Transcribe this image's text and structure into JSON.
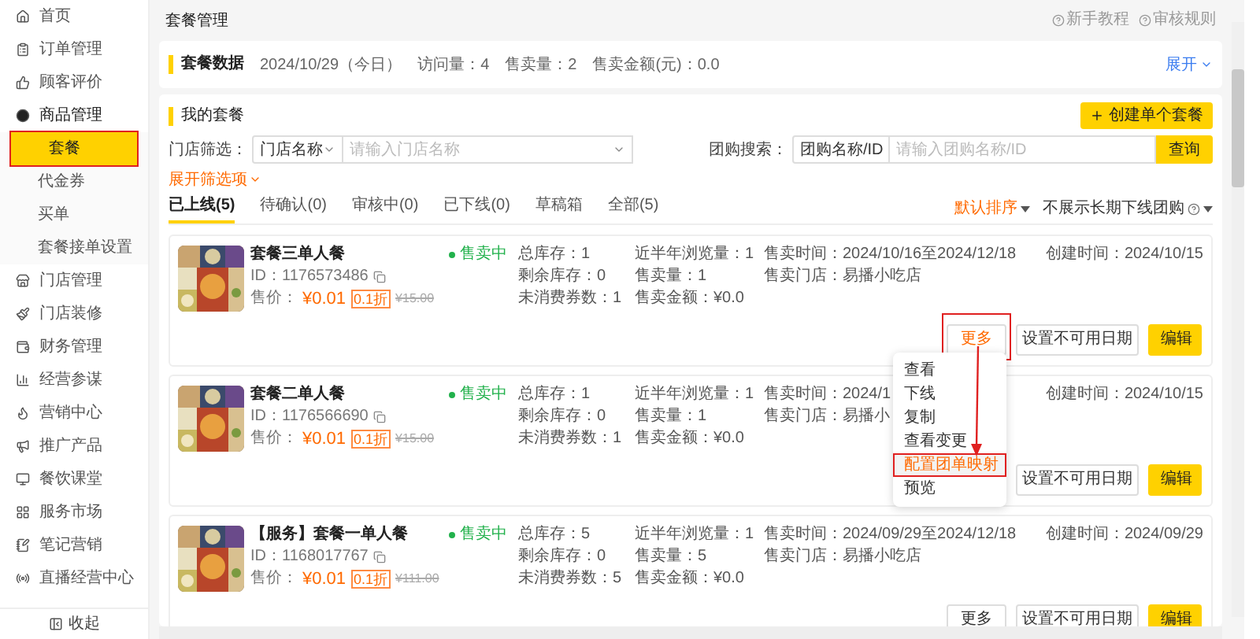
{
  "sidebar": {
    "items": [
      {
        "label": "首页"
      },
      {
        "label": "订单管理"
      },
      {
        "label": "顾客评价"
      },
      {
        "label": "商品管理",
        "expanded": true,
        "children": [
          {
            "label": "套餐",
            "selected": true,
            "highlighted": true
          },
          {
            "label": "代金券",
            "selected": false,
            "highlighted": false
          },
          {
            "label": "买单",
            "selected": false,
            "highlighted": false
          },
          {
            "label": "套餐接单设置",
            "selected": false,
            "highlighted": false
          }
        ]
      },
      {
        "label": "门店管理"
      },
      {
        "label": "门店装修"
      },
      {
        "label": "财务管理"
      },
      {
        "label": "经营参谋"
      },
      {
        "label": "营销中心"
      },
      {
        "label": "推广产品"
      },
      {
        "label": "餐饮课堂"
      },
      {
        "label": "服务市场"
      },
      {
        "label": "笔记营销"
      },
      {
        "label": "直播经营中心"
      }
    ],
    "collapse": "收起"
  },
  "page_title": "套餐管理",
  "help_links": [
    "新手教程",
    "审核规则"
  ],
  "stats_card": {
    "title": "套餐数据",
    "date": "2024/10/29（今日）",
    "items": [
      "访问量：4",
      "售卖量：2",
      "售卖金额(元)：0.0"
    ],
    "expand": "展开"
  },
  "packages": {
    "title": "我的套餐",
    "create_button": "创建单个套餐",
    "store_filter": {
      "label": "门店筛选：",
      "select": "门店名称",
      "placeholder": "请输入门店名称"
    },
    "group_search": {
      "label": "团购搜索：",
      "select": "团购名称/ID",
      "placeholder": "请输入团购名称/ID",
      "button": "查询"
    },
    "more_filters": "展开筛选项",
    "tabs": [
      {
        "label": "已上线(5)",
        "selected": true
      },
      {
        "label": "待确认(0)",
        "selected": false
      },
      {
        "label": "审核中(0)",
        "selected": false
      },
      {
        "label": "已下线(0)",
        "selected": false
      },
      {
        "label": "草稿箱",
        "selected": false
      },
      {
        "label": "全部(5)",
        "selected": false
      }
    ],
    "sort": "默认排序",
    "hide_offline": "不展示长期下线团购",
    "cards": [
      {
        "title": "套餐三单人餐",
        "id": "ID：1176573486",
        "price_label": "售价：",
        "price": "¥0.01",
        "discount": "0.1折",
        "original_price": "¥15.00",
        "status": "售卖中",
        "stock": [
          "总库存：1",
          "剩余库存：0",
          "未消费券数：1"
        ],
        "views": [
          "近半年浏览量：1",
          "售卖量：1",
          "售卖金额：¥0.0"
        ],
        "sale": [
          "售卖时间：2024/10/16至2024/12/18",
          "售卖门店：易播小吃店"
        ],
        "created": "创建时间：2024/10/15",
        "actions": [
          {
            "label": "更多",
            "kind": "more",
            "highlighted": true,
            "menu": [
              {
                "label": "查看",
                "selected": false,
                "highlighted": false
              },
              {
                "label": "下线",
                "selected": false,
                "highlighted": false
              },
              {
                "label": "复制",
                "selected": false,
                "highlighted": false
              },
              {
                "label": "查看变更",
                "selected": false,
                "highlighted": false
              },
              {
                "label": "配置团单映射",
                "selected": true,
                "highlighted": true
              },
              {
                "label": "预览",
                "selected": false,
                "highlighted": false
              }
            ]
          },
          {
            "label": "设置不可用日期",
            "kind": "default",
            "highlighted": false
          },
          {
            "label": "编辑",
            "kind": "primary",
            "highlighted": false
          }
        ]
      },
      {
        "title": "套餐二单人餐",
        "id": "ID：1176566690",
        "price_label": "售价：",
        "price": "¥0.01",
        "discount": "0.1折",
        "original_price": "¥15.00",
        "status": "售卖中",
        "stock": [
          "总库存：1",
          "剩余库存：0",
          "未消费券数：1"
        ],
        "views": [
          "近半年浏览量：1",
          "售卖量：1",
          "售卖金额：¥0.0"
        ],
        "sale": [
          "售卖时间：2024/1",
          "售卖门店：易播小"
        ],
        "created": "创建时间：2024/10/15",
        "actions": [
          {
            "label": "设置不可用日期",
            "kind": "default",
            "highlighted": false
          },
          {
            "label": "编辑",
            "kind": "primary",
            "highlighted": false
          }
        ]
      },
      {
        "title": "【服务】套餐一单人餐",
        "id": "ID：1168017767",
        "price_label": "售价：",
        "price": "¥0.01",
        "discount": "0.1折",
        "original_price": "¥111.00",
        "status": "售卖中",
        "stock": [
          "总库存：5",
          "剩余库存：0",
          "未消费券数：5"
        ],
        "views": [
          "近半年浏览量：1",
          "售卖量：5",
          "售卖金额：¥0.0"
        ],
        "sale": [
          "售卖时间：2024/09/29至2024/12/18",
          "售卖门店：易播小吃店"
        ],
        "created": "创建时间：2024/09/29",
        "actions": [
          {
            "label": "更多",
            "kind": "more",
            "highlighted": false
          },
          {
            "label": "设置不可用日期",
            "kind": "default",
            "highlighted": false
          },
          {
            "label": "编辑",
            "kind": "primary",
            "highlighted": false
          }
        ]
      }
    ]
  }
}
